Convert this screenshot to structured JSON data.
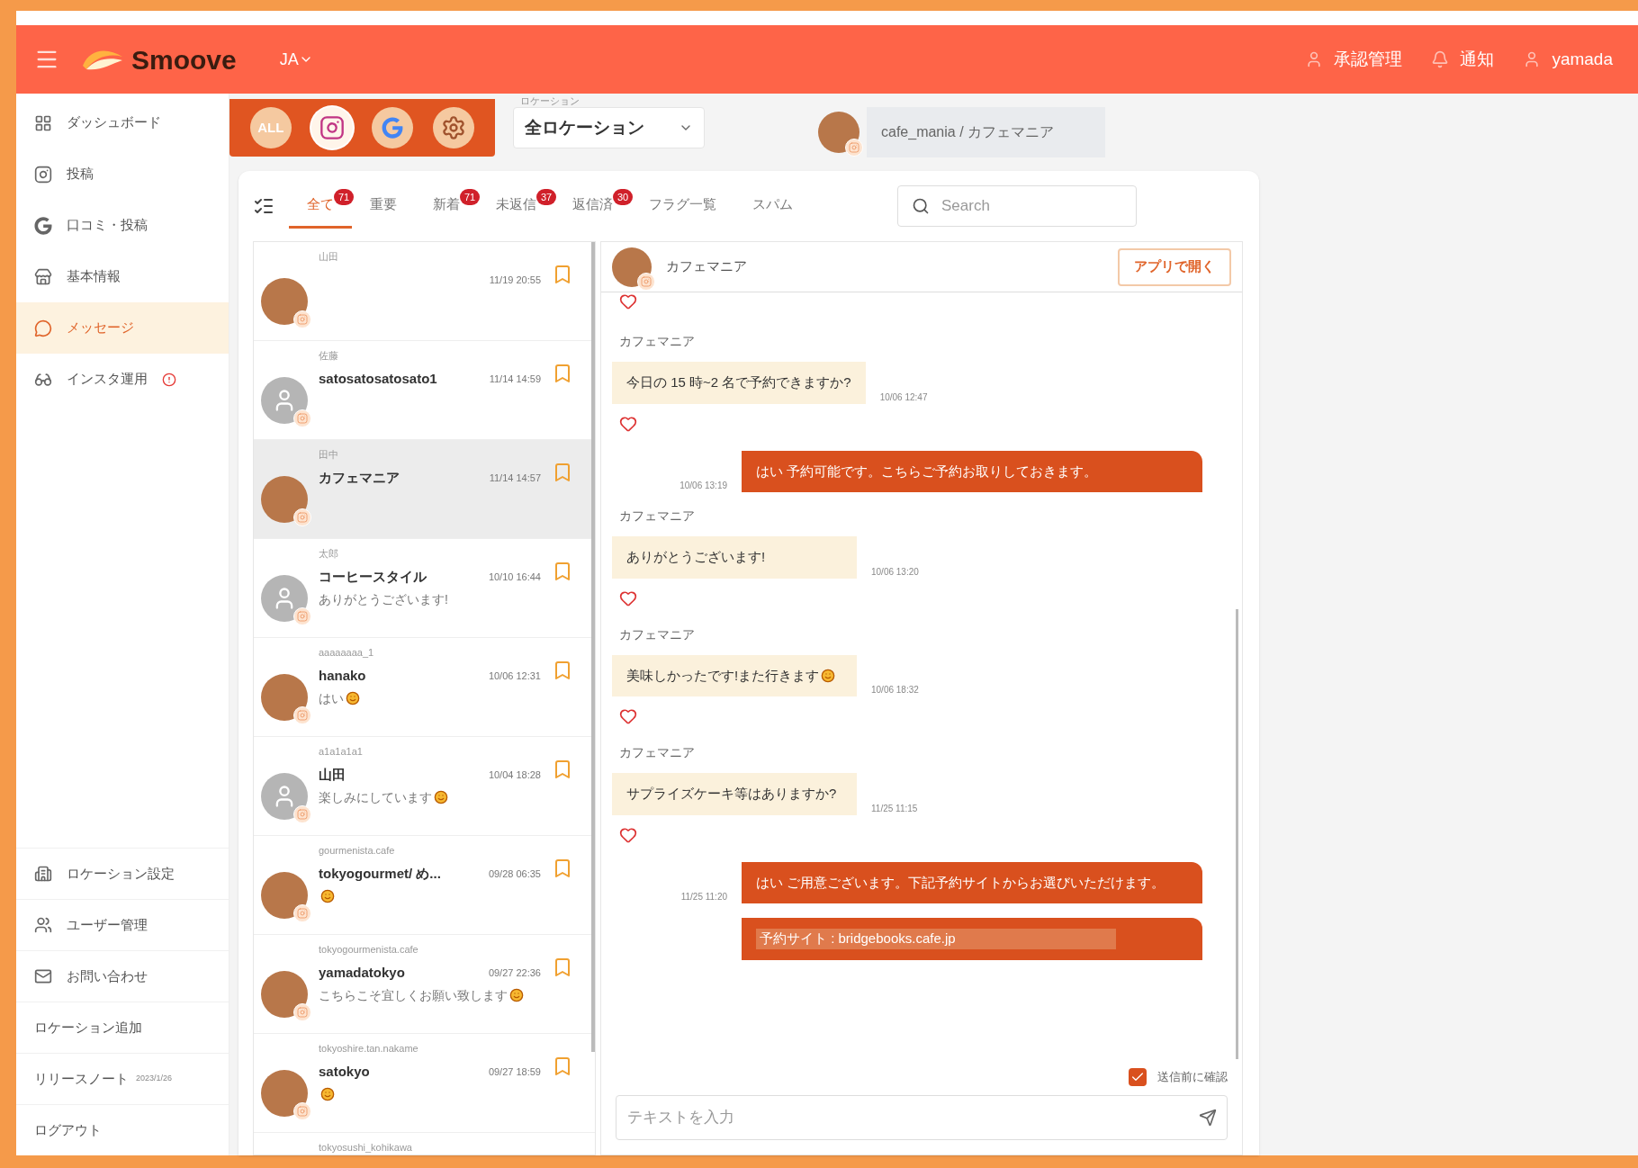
{
  "header": {
    "brand": "Smoove",
    "language": "JA",
    "actions": [
      {
        "kind": "person",
        "label": "承認管理"
      },
      {
        "kind": "bell",
        "label": "通知"
      },
      {
        "kind": "person",
        "label": "yamada"
      }
    ]
  },
  "sidebar": {
    "items": [
      {
        "kind": "dashboard",
        "label": "ダッシュボード",
        "selected": false,
        "alert": false
      },
      {
        "kind": "instagram",
        "label": "投稿",
        "selected": false,
        "alert": false
      },
      {
        "kind": "google",
        "label": "口コミ・投稿",
        "selected": false,
        "alert": false
      },
      {
        "kind": "store",
        "label": "基本情報",
        "selected": false,
        "alert": false
      },
      {
        "kind": "chat",
        "label": "メッセージ",
        "selected": true,
        "alert": false
      },
      {
        "kind": "ops",
        "label": "インスタ運用",
        "selected": false,
        "alert": true
      }
    ],
    "bottom_items": [
      {
        "kind": "location",
        "label": "ロケーション設定"
      },
      {
        "kind": "users",
        "label": "ユーザー管理"
      },
      {
        "kind": "mail",
        "label": "お問い合わせ"
      },
      {
        "kind": "plain",
        "label": "ロケーション追加"
      },
      {
        "kind": "plain",
        "label": "リリースノート",
        "note": "2023/1/26"
      },
      {
        "kind": "plain",
        "label": "ログアウト"
      }
    ]
  },
  "platform_filters": [
    {
      "kind": "all",
      "label": "ALL",
      "selected": false
    },
    {
      "kind": "instagram",
      "selected": true
    },
    {
      "kind": "google",
      "selected": false
    },
    {
      "kind": "settings",
      "selected": false
    }
  ],
  "location_select": {
    "label": "ロケーション",
    "value": "全ロケーション"
  },
  "account": {
    "label": "cafe_mania / カフェマニア"
  },
  "tabs": [
    {
      "label": "全て",
      "badge": "71",
      "selected": true
    },
    {
      "label": "重要",
      "selected": false
    },
    {
      "label": "新着",
      "badge": "71",
      "selected": false
    },
    {
      "label": "未返信",
      "badge": "37",
      "selected": false
    },
    {
      "label": "返信済",
      "badge": "30",
      "selected": false
    },
    {
      "label": "フラグ一覧",
      "selected": false
    },
    {
      "label": "スパム",
      "selected": false
    }
  ],
  "search": {
    "placeholder": "Search"
  },
  "conversations": [
    {
      "subname": "山田",
      "time": "11/19 20:55",
      "avatar": {
        "kind": "photo"
      },
      "selected": false,
      "emoji": false
    },
    {
      "subname": "佐藤",
      "name": "satosatosatosato1",
      "time": "11/14 14:59",
      "avatar": {
        "kind": "default"
      },
      "selected": false,
      "emoji": false
    },
    {
      "subname": "田中",
      "name": "カフェマニア",
      "time": "11/14 14:57",
      "avatar": {
        "kind": "photo"
      },
      "selected": true,
      "emoji": false
    },
    {
      "subname": "太郎",
      "name": "コーヒースタイル",
      "time": "10/10 16:44",
      "preview": "ありがとうございます!",
      "avatar": {
        "kind": "default"
      },
      "selected": false,
      "emoji": false
    },
    {
      "subname": "aaaaaaaa_1",
      "name": "hanako",
      "time": "10/06 12:31",
      "preview": "はい",
      "avatar": {
        "kind": "photo"
      },
      "selected": false,
      "emoji": true
    },
    {
      "subname": "a1a1a1a1",
      "name": "山田",
      "time": "10/04 18:28",
      "preview": "楽しみにしています",
      "avatar": {
        "kind": "default"
      },
      "selected": false,
      "emoji": true
    },
    {
      "subname": "gourmenista.cafe",
      "name": "tokyogourmet/ め...",
      "time": "09/28 06:35",
      "avatar": {
        "kind": "photo"
      },
      "selected": false,
      "emoji": true
    },
    {
      "subname": "tokyogourmenista.cafe",
      "name": "yamadatokyo",
      "time": "09/27 22:36",
      "preview": "こちらこそ宜しくお願い致します",
      "avatar": {
        "kind": "photo"
      },
      "selected": false,
      "emoji": true
    },
    {
      "subname": "tokyoshire.tan.nakame",
      "name": "satokyo",
      "time": "09/27 18:59",
      "avatar": {
        "kind": "photo"
      },
      "selected": false,
      "emoji": true
    },
    {
      "subname": "tokyosushi_kohikawa",
      "selected": false,
      "emoji": false
    }
  ],
  "chat": {
    "title": "カフェマニア",
    "open_button": "アプリで開く",
    "messages": [
      {
        "kind": "reaction"
      },
      {
        "kind": "received",
        "sender": "カフェマニア",
        "text": "今日の 15 時~2 名で予約できますか?",
        "time": "10/06 12:47",
        "emoji": false
      },
      {
        "kind": "sent",
        "text": "はい 予約可能です。こちらご予約お取りしておきます。",
        "time": "10/06 13:19"
      },
      {
        "kind": "received",
        "sender": "カフェマニア",
        "text": "ありがとうございます!",
        "time": "10/06 13:20",
        "emoji": false
      },
      {
        "kind": "received",
        "sender": "カフェマニア",
        "text": "美味しかったです!また行きます",
        "time": "10/06 18:32",
        "emoji": true
      },
      {
        "kind": "received",
        "sender": "カフェマニア",
        "text": "サプライズケーキ等はありますか?",
        "time": "11/25 11:15",
        "emoji": false
      },
      {
        "kind": "sent",
        "text": "はい ご用意ございます。下記予約サイトからお選びいただけます。",
        "time": "11/25 11:20"
      },
      {
        "kind": "sent_link",
        "text": "予約サイト : bridgebooks.cafe.jp"
      }
    ],
    "confirm": {
      "label": "送信前に確認",
      "checked": true
    },
    "input": {
      "placeholder": "テキストを入力"
    }
  }
}
